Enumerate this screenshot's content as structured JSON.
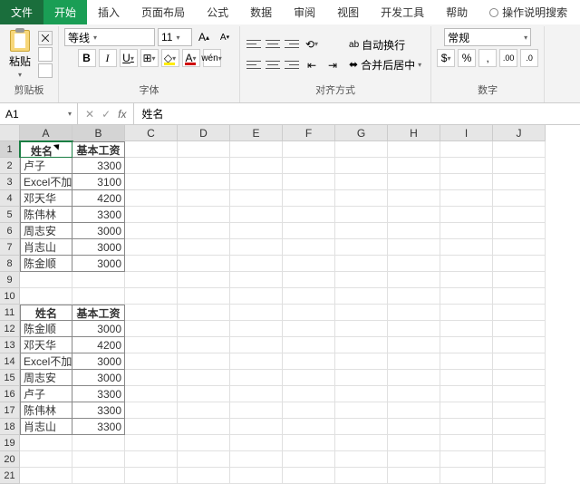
{
  "tabs": {
    "file": "文件",
    "home": "开始",
    "insert": "插入",
    "layout": "页面布局",
    "formula": "公式",
    "data": "数据",
    "review": "审阅",
    "view": "视图",
    "dev": "开发工具",
    "help": "帮助",
    "tell": "操作说明搜索"
  },
  "ribbon": {
    "clipboard": {
      "paste": "粘贴",
      "label": "剪贴板"
    },
    "font": {
      "name": "等线",
      "size": "11",
      "label": "字体",
      "bold": "B",
      "italic": "I",
      "underline": "U"
    },
    "align": {
      "wrap": "自动换行",
      "merge": "合并后居中",
      "label": "对齐方式"
    },
    "number": {
      "format": "常规",
      "label": "数字"
    }
  },
  "nameBox": {
    "ref": "A1",
    "value": "姓名"
  },
  "cols": [
    "A",
    "B",
    "C",
    "D",
    "E",
    "F",
    "G",
    "H",
    "I",
    "J"
  ],
  "rows": 21,
  "table1": {
    "headers": [
      "姓名",
      "基本工资"
    ],
    "data": [
      [
        "卢子",
        "3300"
      ],
      [
        "Excel不加班",
        "3100"
      ],
      [
        "邓天华",
        "4200"
      ],
      [
        "陈伟林",
        "3300"
      ],
      [
        "周志安",
        "3000"
      ],
      [
        "肖志山",
        "3000"
      ],
      [
        "陈金顺",
        "3000"
      ]
    ]
  },
  "table2": {
    "headers": [
      "姓名",
      "基本工资"
    ],
    "data": [
      [
        "陈金顺",
        "3000"
      ],
      [
        "邓天华",
        "4200"
      ],
      [
        "Excel不加班",
        "3000"
      ],
      [
        "周志安",
        "3000"
      ],
      [
        "卢子",
        "3300"
      ],
      [
        "陈伟林",
        "3300"
      ],
      [
        "肖志山",
        "3300"
      ]
    ]
  }
}
